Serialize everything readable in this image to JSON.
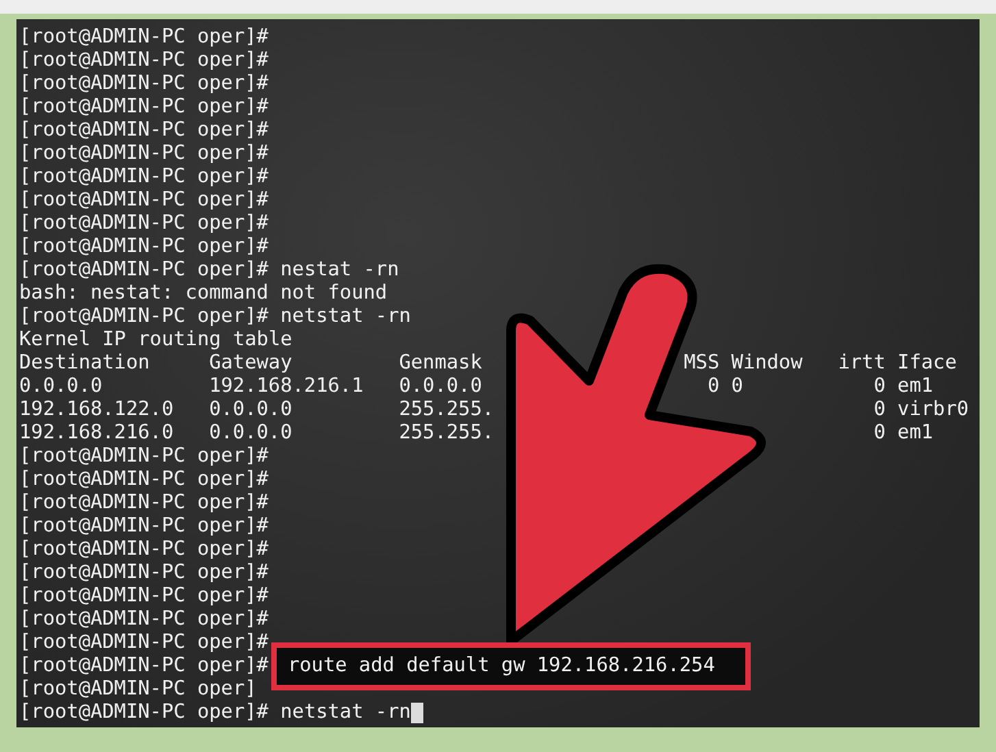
{
  "terminal": {
    "lines": [
      {
        "kind": "prompt",
        "prompt": "[root@ADMIN-PC oper]#"
      },
      {
        "kind": "prompt",
        "prompt": "[root@ADMIN-PC oper]#"
      },
      {
        "kind": "prompt",
        "prompt": "[root@ADMIN-PC oper]#"
      },
      {
        "kind": "prompt",
        "prompt": "[root@ADMIN-PC oper]#"
      },
      {
        "kind": "prompt",
        "prompt": "[root@ADMIN-PC oper]#"
      },
      {
        "kind": "prompt",
        "prompt": "[root@ADMIN-PC oper]#"
      },
      {
        "kind": "prompt",
        "prompt": "[root@ADMIN-PC oper]#"
      },
      {
        "kind": "prompt",
        "prompt": "[root@ADMIN-PC oper]#"
      },
      {
        "kind": "prompt",
        "prompt": "[root@ADMIN-PC oper]#"
      },
      {
        "kind": "prompt",
        "prompt": "[root@ADMIN-PC oper]#"
      },
      {
        "kind": "prompt",
        "prompt": "[root@ADMIN-PC oper]#",
        "command": "nestat -rn"
      },
      {
        "kind": "output",
        "text": "bash: nestat: command not found"
      },
      {
        "kind": "prompt",
        "prompt": "[root@ADMIN-PC oper]#",
        "command": "netstat -rn"
      },
      {
        "kind": "output",
        "text": "Kernel IP routing table"
      },
      {
        "kind": "table_header",
        "columns": [
          "Destination",
          "Gateway",
          "Genmask",
          "MSS",
          "Window",
          "irtt",
          "Iface"
        ]
      },
      {
        "kind": "table_row",
        "cells": [
          "0.0.0.0",
          "192.168.216.1",
          "0.0.0.0",
          "0",
          "0",
          "0",
          "em1"
        ]
      },
      {
        "kind": "table_row",
        "cells": [
          "192.168.122.0",
          "0.0.0.0",
          "255.255.",
          null,
          null,
          "0",
          "virbr0"
        ]
      },
      {
        "kind": "table_row",
        "cells": [
          "192.168.216.0",
          "0.0.0.0",
          "255.255.",
          null,
          null,
          "0",
          "em1"
        ]
      },
      {
        "kind": "prompt",
        "prompt": "[root@ADMIN-PC oper]#"
      },
      {
        "kind": "prompt",
        "prompt": "[root@ADMIN-PC oper]#"
      },
      {
        "kind": "prompt",
        "prompt": "[root@ADMIN-PC oper]#"
      },
      {
        "kind": "prompt",
        "prompt": "[root@ADMIN-PC oper]#"
      },
      {
        "kind": "prompt",
        "prompt": "[root@ADMIN-PC oper]#"
      },
      {
        "kind": "prompt",
        "prompt": "[root@ADMIN-PC oper]#"
      },
      {
        "kind": "prompt",
        "prompt": "[root@ADMIN-PC oper]#"
      },
      {
        "kind": "prompt",
        "prompt": "[root@ADMIN-PC oper]#"
      },
      {
        "kind": "prompt",
        "prompt": "[root@ADMIN-PC oper]#"
      },
      {
        "kind": "highlighted",
        "prompt": "[root@ADMIN-PC oper]#",
        "command": "route add default gw 192.168.216.254"
      },
      {
        "kind": "prompt",
        "prompt": "[root@ADMIN-PC oper]"
      },
      {
        "kind": "current",
        "prompt": "[root@ADMIN-PC oper]#",
        "command": "netstat -rn"
      }
    ]
  }
}
